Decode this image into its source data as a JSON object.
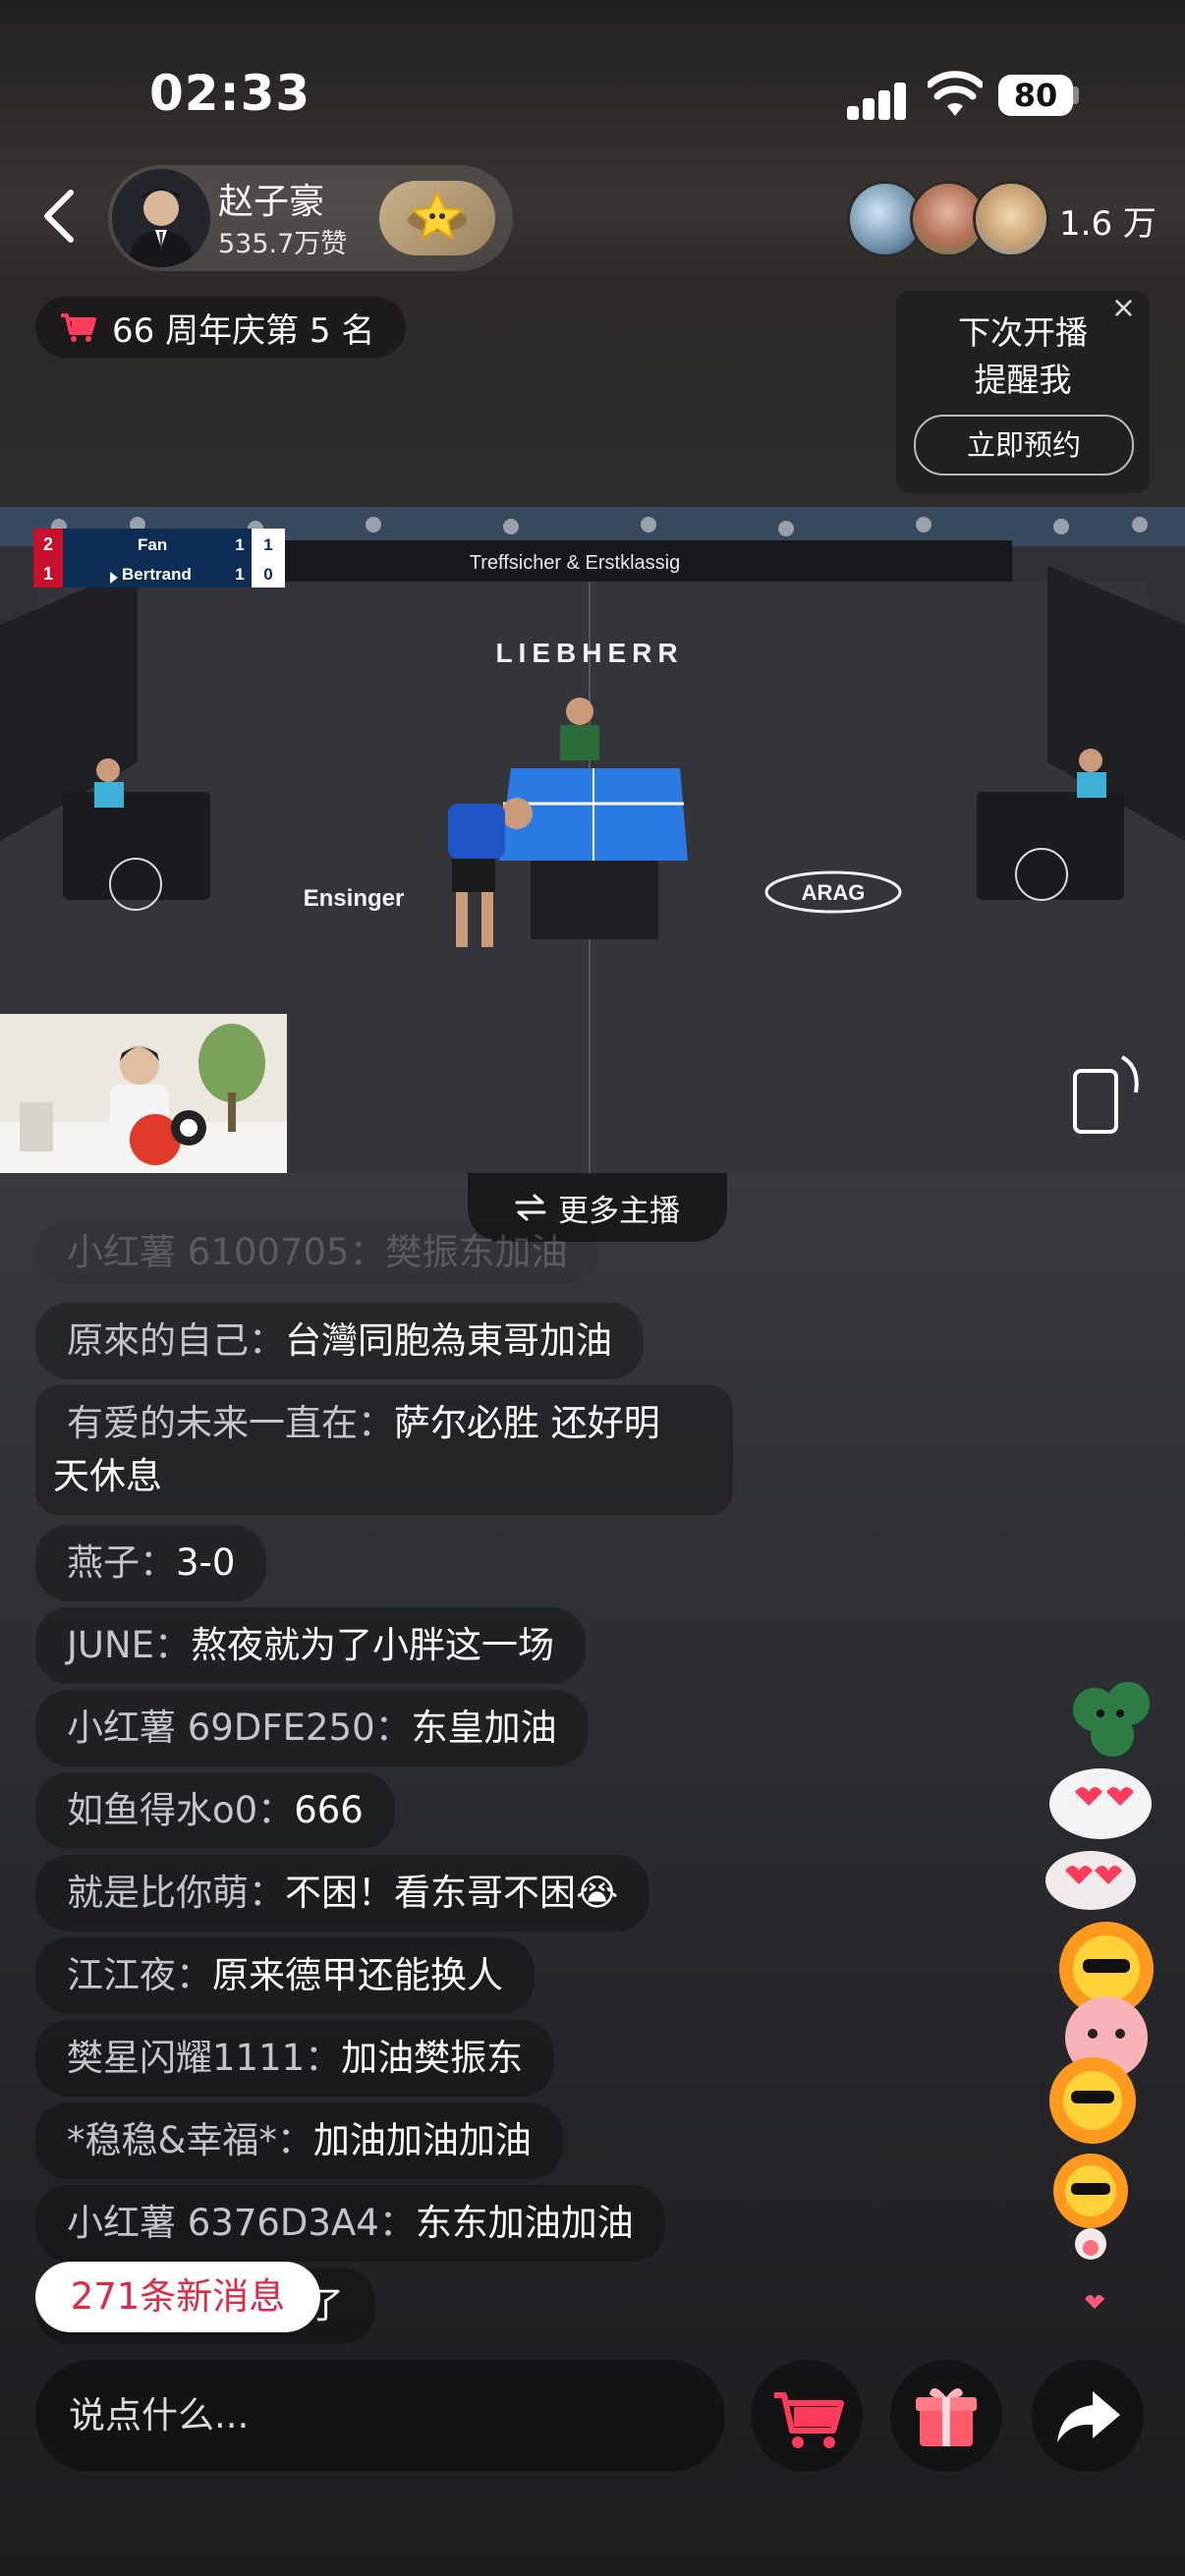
{
  "status": {
    "time": "02:33",
    "battery": "80"
  },
  "host": {
    "name": "赵子豪",
    "likes": "535.7万赞"
  },
  "viewers": {
    "count": "1.6 万"
  },
  "rank": {
    "label": "66 周年庆第 5 名"
  },
  "remind": {
    "line1": "下次开播",
    "line2": "提醒我",
    "button": "立即预约",
    "close": "×"
  },
  "scoreboard": {
    "players": [
      {
        "name": "Fan",
        "sets": "2",
        "games": "1",
        "points": "1"
      },
      {
        "name": "Bertrand",
        "sets": "1",
        "games": "1",
        "points": "0"
      }
    ]
  },
  "venue": {
    "sponsor_banner": "Treffsicher & Erstklassig",
    "floor_logo": "LIEBHERR",
    "floor_left": "Ensinger",
    "floor_right": "ARAG",
    "barrier": "ARAG"
  },
  "more_hosts": {
    "label": "更多主播"
  },
  "chat": {
    "partial_text": "小红薯 6100705：樊振东加油",
    "messages": [
      {
        "user": "原來的自己：",
        "text": "台灣同胞為東哥加油"
      },
      {
        "user": "有爱的未来一直在：",
        "text": "萨尔必胜  还好明",
        "text2": "天休息"
      },
      {
        "user": "燕子：",
        "text": "3-0"
      },
      {
        "user": "JUNE：",
        "text": "熬夜就为了小胖这一场"
      },
      {
        "user": "小红薯 69DFE250：",
        "text": "东皇加油"
      },
      {
        "user": "如鱼得水o0：",
        "text": "666"
      },
      {
        "user": "就是比你萌：",
        "text": "不困！看东哥不困😭"
      },
      {
        "user": "江江夜：",
        "text": "原来德甲还能换人"
      },
      {
        "user": "樊星闪耀1111：",
        "text": "加油樊振东"
      },
      {
        "user": "*稳稳&幸福*：",
        "text": "加油加油加油"
      },
      {
        "user": "小红薯 6376D3A4：",
        "text": "东东加油加油"
      },
      {
        "user": "",
        "text": "赞了"
      }
    ]
  },
  "new_messages": {
    "label": "271条新消息"
  },
  "input": {
    "placeholder": "说点什么..."
  },
  "colors": {
    "accent": "#e02847",
    "cart": "#ff3b5c",
    "table": "#2c7be5"
  }
}
